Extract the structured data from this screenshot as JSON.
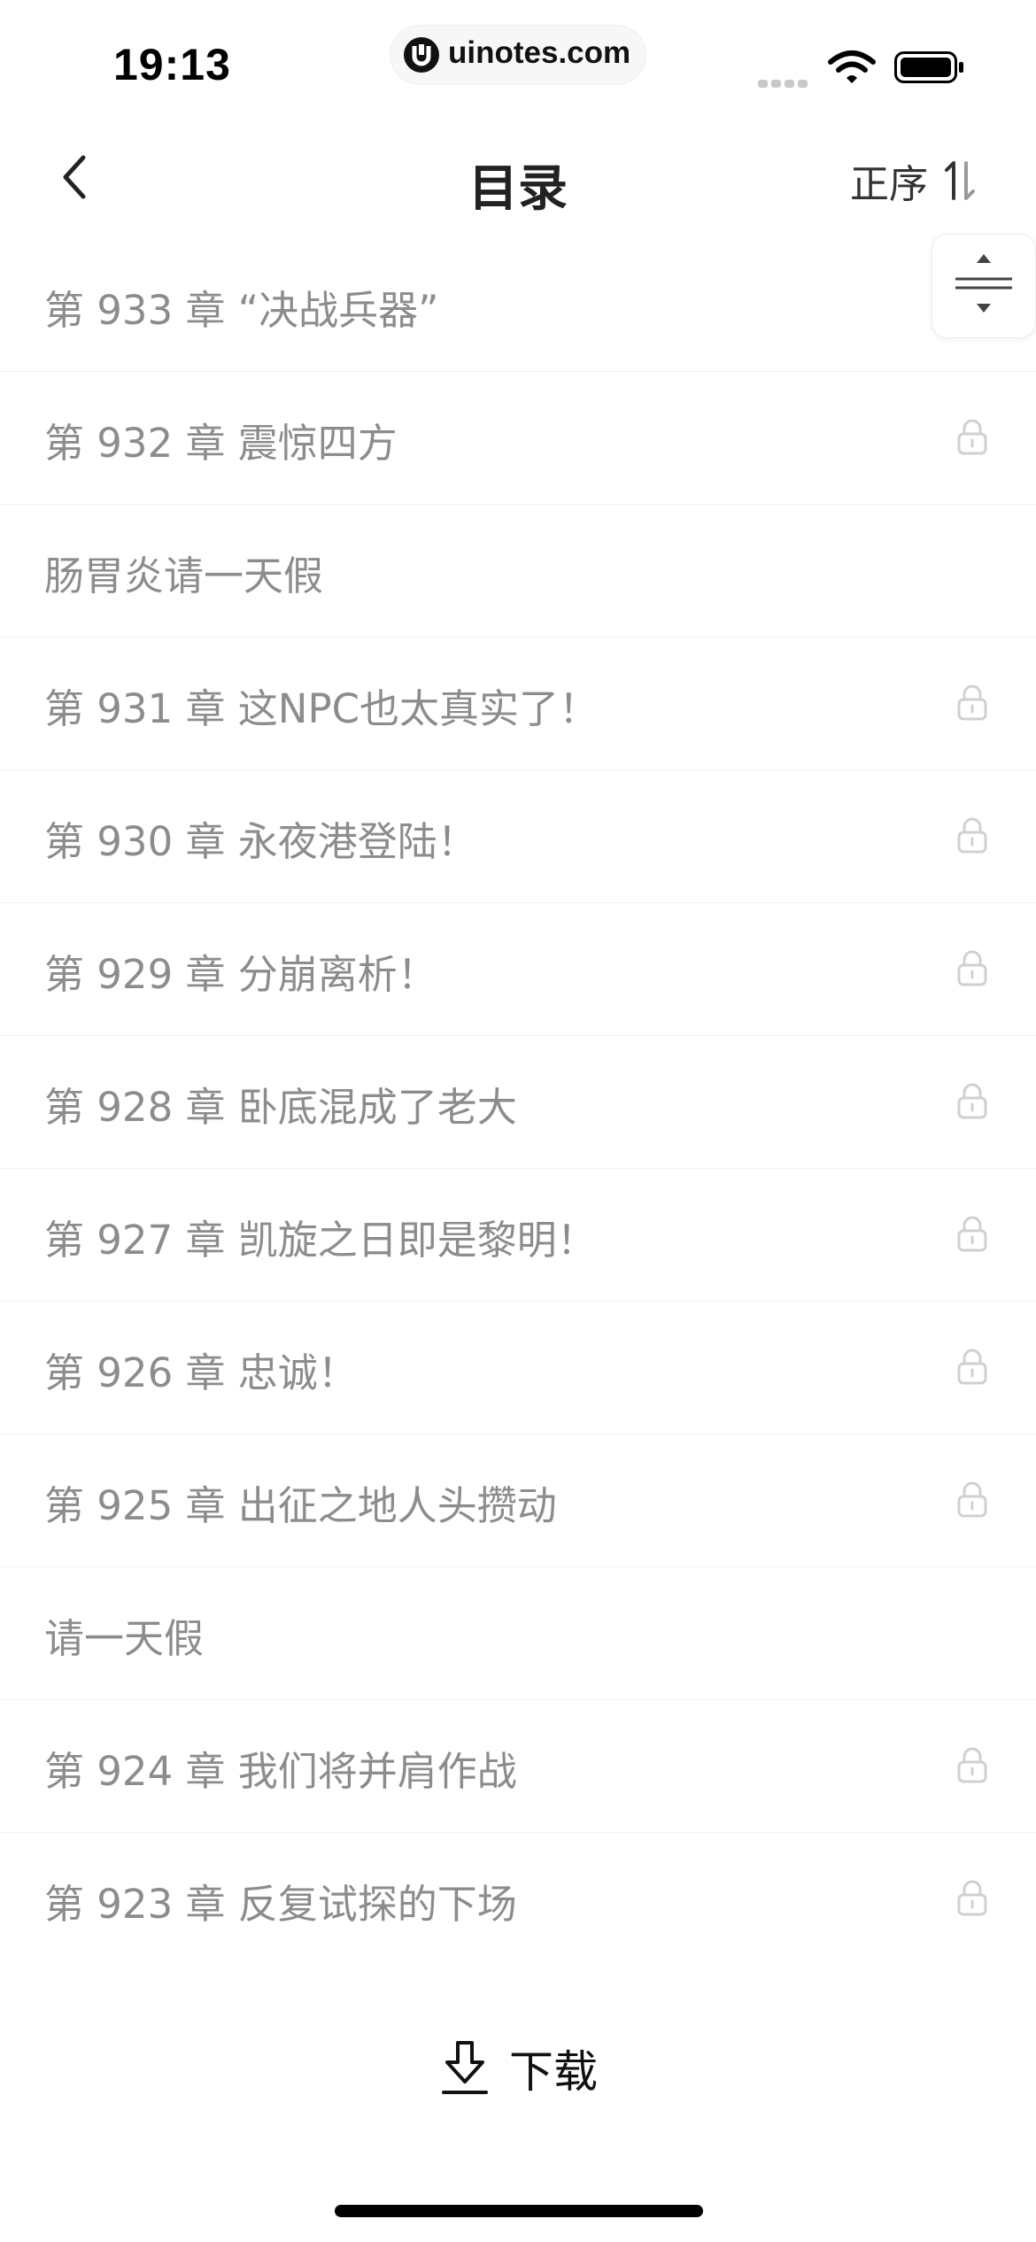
{
  "status_bar": {
    "time": "19:13",
    "url": "uinotes.com",
    "icons": [
      "signal-icon",
      "wifi-icon",
      "battery-icon"
    ]
  },
  "nav": {
    "back_icon": "chevron-left-icon",
    "title": "目录",
    "sort_label": "正序",
    "sort_icon": "sort-arrows-icon"
  },
  "chapters": [
    {
      "title": "第 933 章 “决战兵器”",
      "locked": false
    },
    {
      "title": "第 932 章 震惊四方",
      "locked": true
    },
    {
      "title": "肠胃炎请一天假",
      "locked": false
    },
    {
      "title": "第 931 章 这NPC也太真实了！",
      "locked": true
    },
    {
      "title": "第 930 章 永夜港登陆！",
      "locked": true
    },
    {
      "title": "第 929 章 分崩离析！",
      "locked": true
    },
    {
      "title": "第 928 章 卧底混成了老大",
      "locked": true
    },
    {
      "title": "第 927 章 凯旋之日即是黎明！",
      "locked": true
    },
    {
      "title": "第 926 章 忠诚！",
      "locked": true
    },
    {
      "title": "第 925 章 出征之地人头攒动",
      "locked": true
    },
    {
      "title": "请一天假",
      "locked": false
    },
    {
      "title": "第 924 章 我们将并肩作战",
      "locked": true
    },
    {
      "title": "第 923 章 反复试探的下场",
      "locked": true
    }
  ],
  "scroll_control": {
    "icon": "scroll-top-bottom-icon"
  },
  "download": {
    "label": "下载",
    "icon": "download-icon"
  },
  "colors": {
    "chapter_text": "#8c8c8c",
    "title_text": "#222222",
    "lock": "#d0d0d0",
    "divider": "#f0f0f0"
  }
}
